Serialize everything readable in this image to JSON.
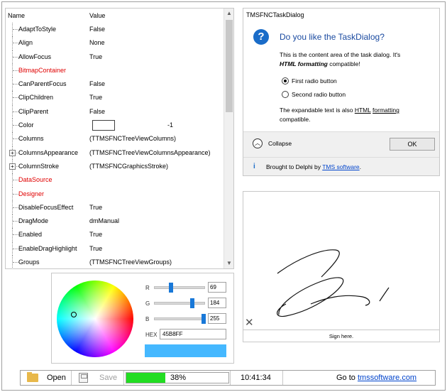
{
  "grid": {
    "headers": {
      "name": "Name",
      "value": "Value"
    },
    "rows": [
      {
        "name": "AdaptToStyle",
        "value": "False",
        "red": false,
        "expandable": false
      },
      {
        "name": "Align",
        "value": "None",
        "red": false,
        "expandable": false
      },
      {
        "name": "AllowFocus",
        "value": "True",
        "red": false,
        "expandable": false
      },
      {
        "name": "BitmapContainer",
        "value": "",
        "red": true,
        "expandable": false
      },
      {
        "name": "CanParentFocus",
        "value": "False",
        "red": false,
        "expandable": false
      },
      {
        "name": "ClipChildren",
        "value": "True",
        "red": false,
        "expandable": false
      },
      {
        "name": "ClipParent",
        "value": "False",
        "red": false,
        "expandable": false
      },
      {
        "name": "Color",
        "value": "-1",
        "red": false,
        "expandable": false,
        "color": true
      },
      {
        "name": "Columns",
        "value": "(TTMSFNCTreeViewColumns)",
        "red": false,
        "expandable": false
      },
      {
        "name": "ColumnsAppearance",
        "value": "(TTMSFNCTreeViewColumnsAppearance)",
        "red": false,
        "expandable": true
      },
      {
        "name": "ColumnStroke",
        "value": "(TTMSFNCGraphicsStroke)",
        "red": false,
        "expandable": true
      },
      {
        "name": "DataSource",
        "value": "",
        "red": true,
        "expandable": false
      },
      {
        "name": "Designer",
        "value": "",
        "red": true,
        "expandable": false
      },
      {
        "name": "DisableFocusEffect",
        "value": "True",
        "red": false,
        "expandable": false
      },
      {
        "name": "DragMode",
        "value": "dmManual",
        "red": false,
        "expandable": false
      },
      {
        "name": "Enabled",
        "value": "True",
        "red": false,
        "expandable": false
      },
      {
        "name": "EnableDragHighlight",
        "value": "True",
        "red": false,
        "expandable": false
      },
      {
        "name": "Groups",
        "value": "(TTMSFNCTreeViewGroups)",
        "red": false,
        "expandable": false
      }
    ],
    "scroll_up": "▲",
    "scroll_down": "▼"
  },
  "picker": {
    "r_label": "R",
    "r_value": "69",
    "g_label": "G",
    "g_value": "184",
    "b_label": "B",
    "b_value": "255",
    "hex_label": "HEX",
    "hex_value": "45B8FF",
    "preview_color": "#45b8ff"
  },
  "dialog": {
    "title": "TMSFNCTaskDialog",
    "icon": "?",
    "heading": "Do you like the TaskDialog?",
    "content_line1": "This is the content area of the task dialog. It's",
    "content_bold": "HTML formatting",
    "content_line2": " compatible!",
    "radio1": "First radio button",
    "radio2": "Second radio button",
    "exp_prefix": "The expandable text is also ",
    "exp_html": "HTML",
    "exp_space": " ",
    "exp_formatting": "formatting",
    "exp_suffix": "compatible.",
    "collapse_label": "Collapse",
    "ok_label": "OK",
    "footer_prefix": "Brought to Delphi by ",
    "footer_link": "TMS software",
    "footer_suffix": "."
  },
  "signature": {
    "clear_icon": "✕",
    "label": "Sign here."
  },
  "toolbar": {
    "open_label": "Open",
    "save_label": "Save",
    "progress_text": "38%",
    "progress_fraction": 0.38,
    "time": "10:41:34",
    "goto_prefix": "Go to ",
    "goto_link": "tmssoftware.com"
  }
}
